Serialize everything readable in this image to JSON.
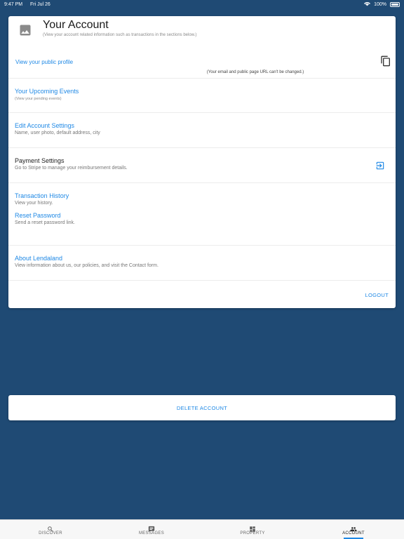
{
  "status_bar": {
    "time": "9:47 PM",
    "date": "Fri Jul 26",
    "battery": "100%"
  },
  "header": {
    "title": "Your Account",
    "subtitle": "(View your account related information such as transactions in the sections below.)"
  },
  "profile": {
    "link": "View your public profile",
    "note": "(Your email and public page URL can't be changed.)"
  },
  "items": [
    {
      "title": "Your Upcoming Events",
      "desc": "(View your pending events)"
    },
    {
      "title": "Edit Account Settings",
      "desc": "Name, user photo, default address, city"
    },
    {
      "title": "Payment Settings",
      "desc": "Go to Stripe to manage your reimbursement details."
    },
    {
      "title": "Transaction History",
      "desc": "View your history."
    },
    {
      "title": "Reset Password",
      "desc": "Send a reset password link."
    },
    {
      "title": "About Lendaland",
      "desc": "View information about us, our policies, and visit the Contact form."
    }
  ],
  "logout": "LOGOUT",
  "delete_account": "DELETE ACCOUNT",
  "tabs": [
    {
      "label": "DISCOVER",
      "icon": "search-icon"
    },
    {
      "label": "MESSAGES",
      "icon": "message-icon"
    },
    {
      "label": "PROPERTY",
      "icon": "dashboard-icon"
    },
    {
      "label": "ACCOUNT",
      "icon": "people-icon",
      "active": true
    }
  ],
  "colors": {
    "background": "#1f4a74",
    "accent": "#1e88e5",
    "card": "#ffffff"
  }
}
